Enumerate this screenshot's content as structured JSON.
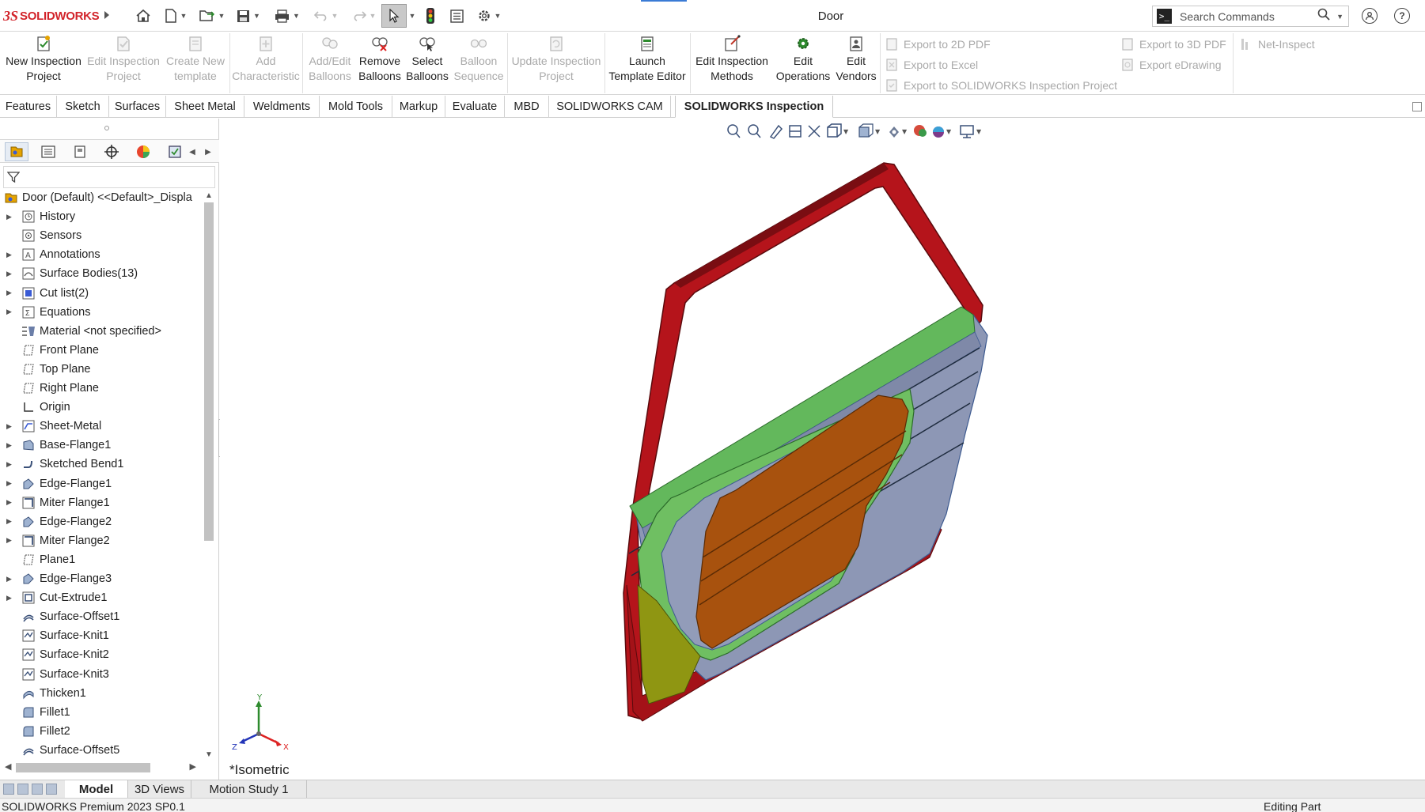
{
  "titlebar": {
    "logo_ds": "3S",
    "logo_text": "SOLIDWORKS",
    "document_title": "Door",
    "search_placeholder": "Search Commands",
    "help_glyph": "?"
  },
  "quick_access": [
    "home-icon",
    "new-document-icon",
    "open-icon",
    "save-icon",
    "print-icon",
    "undo-icon",
    "redo-icon",
    "select-icon",
    "traffic-light-icon",
    "file-properties-icon",
    "options-gear-icon"
  ],
  "ribbon": {
    "buttons": [
      {
        "id": "new-inspection-project",
        "label": "New Inspection\nProject",
        "enabled": true
      },
      {
        "id": "edit-inspection-project",
        "label": "Edit Inspection\nProject",
        "enabled": false
      },
      {
        "id": "create-new-template",
        "label": "Create New\ntemplate",
        "enabled": false
      },
      {
        "id": "add-characteristic",
        "label": "Add\nCharacteristic",
        "enabled": false
      },
      {
        "id": "add-edit-balloons",
        "label": "Add/Edit\nBalloons",
        "enabled": false
      },
      {
        "id": "remove-balloons",
        "label": "Remove\nBalloons",
        "enabled": true
      },
      {
        "id": "select-balloons",
        "label": "Select\nBalloons",
        "enabled": true
      },
      {
        "id": "balloon-sequence",
        "label": "Balloon\nSequence",
        "enabled": false
      },
      {
        "id": "update-inspection-project",
        "label": "Update Inspection\nProject",
        "enabled": false
      },
      {
        "id": "launch-template-editor",
        "label": "Launch\nTemplate Editor",
        "enabled": true
      },
      {
        "id": "edit-inspection-methods",
        "label": "Edit Inspection\nMethods",
        "enabled": true
      },
      {
        "id": "edit-operations",
        "label": "Edit\nOperations",
        "enabled": true
      },
      {
        "id": "edit-vendors",
        "label": "Edit\nVendors",
        "enabled": true
      }
    ],
    "export_2d_pdf": "Export to 2D PDF",
    "export_excel": "Export to Excel",
    "export_inspection_project": "Export to SOLIDWORKS Inspection Project",
    "export_3d_pdf": "Export to 3D PDF",
    "export_edrawing": "Export eDrawing",
    "net_inspect": "Net-Inspect"
  },
  "tabs": [
    "Features",
    "Sketch",
    "Surfaces",
    "Sheet Metal",
    "Weldments",
    "Mold Tools",
    "Markup",
    "Evaluate",
    "MBD",
    "SOLIDWORKS CAM",
    "SOLIDWORKS Inspection"
  ],
  "active_tab": "SOLIDWORKS Inspection",
  "tree": {
    "root": "Door (Default) <<Default>_Displa",
    "items": [
      {
        "label": "History",
        "expandable": true,
        "icon": "history-icon"
      },
      {
        "label": "Sensors",
        "expandable": false,
        "icon": "sensors-icon"
      },
      {
        "label": "Annotations",
        "expandable": true,
        "icon": "annotations-icon"
      },
      {
        "label": "Surface Bodies(13)",
        "expandable": true,
        "icon": "surface-bodies-icon"
      },
      {
        "label": "Cut list(2)",
        "expandable": true,
        "icon": "cut-list-icon"
      },
      {
        "label": "Equations",
        "expandable": true,
        "icon": "equations-icon"
      },
      {
        "label": "Material <not specified>",
        "expandable": false,
        "icon": "material-icon"
      },
      {
        "label": "Front Plane",
        "expandable": false,
        "icon": "plane-icon"
      },
      {
        "label": "Top Plane",
        "expandable": false,
        "icon": "plane-icon"
      },
      {
        "label": "Right Plane",
        "expandable": false,
        "icon": "plane-icon"
      },
      {
        "label": "Origin",
        "expandable": false,
        "icon": "origin-icon"
      },
      {
        "label": "Sheet-Metal",
        "expandable": true,
        "icon": "sheet-metal-icon"
      },
      {
        "label": "Base-Flange1",
        "expandable": true,
        "icon": "base-flange-icon"
      },
      {
        "label": "Sketched Bend1",
        "expandable": true,
        "icon": "sketched-bend-icon"
      },
      {
        "label": "Edge-Flange1",
        "expandable": true,
        "icon": "edge-flange-icon"
      },
      {
        "label": "Miter Flange1",
        "expandable": true,
        "icon": "miter-flange-icon"
      },
      {
        "label": "Edge-Flange2",
        "expandable": true,
        "icon": "edge-flange-icon"
      },
      {
        "label": "Miter Flange2",
        "expandable": true,
        "icon": "miter-flange-icon"
      },
      {
        "label": "Plane1",
        "expandable": false,
        "icon": "plane-icon"
      },
      {
        "label": "Edge-Flange3",
        "expandable": true,
        "icon": "edge-flange-icon"
      },
      {
        "label": "Cut-Extrude1",
        "expandable": true,
        "icon": "cut-extrude-icon"
      },
      {
        "label": "Surface-Offset1",
        "expandable": false,
        "icon": "surface-offset-icon"
      },
      {
        "label": "Surface-Knit1",
        "expandable": false,
        "icon": "surface-knit-icon"
      },
      {
        "label": "Surface-Knit2",
        "expandable": false,
        "icon": "surface-knit-icon"
      },
      {
        "label": "Surface-Knit3",
        "expandable": false,
        "icon": "surface-knit-icon"
      },
      {
        "label": "Thicken1",
        "expandable": false,
        "icon": "thicken-icon"
      },
      {
        "label": "Fillet1",
        "expandable": false,
        "icon": "fillet-icon"
      },
      {
        "label": "Fillet2",
        "expandable": false,
        "icon": "fillet-icon"
      },
      {
        "label": "Surface-Offset5",
        "expandable": false,
        "icon": "surface-offset-icon"
      }
    ]
  },
  "viewport": {
    "view_label": "*Isometric",
    "triad": {
      "x": "X",
      "y": "Y",
      "z": "Z"
    }
  },
  "bottom_tabs": [
    "Model",
    "3D Views",
    "Motion Study 1"
  ],
  "active_bottom_tab": "Model",
  "status": {
    "left": "SOLIDWORKS Premium 2023 SP0.1",
    "right": "Editing Part"
  },
  "colors": {
    "frame_red": "#b5141b",
    "panel_gray": "#8d97b5",
    "trim_green": "#63b85c",
    "inner_orange": "#a8520e",
    "olive": "#8f9612"
  }
}
